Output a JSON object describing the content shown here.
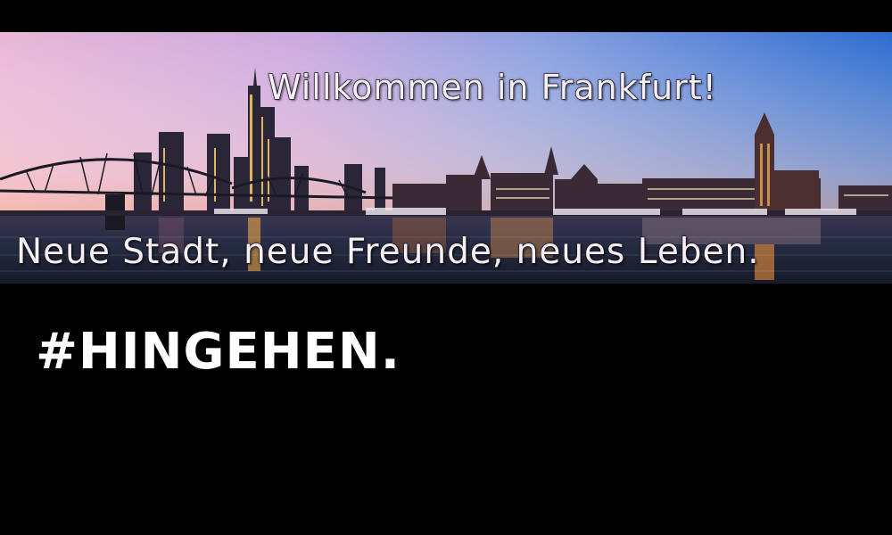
{
  "banner": {
    "headline": "Willkommen in Frankfurt!",
    "subline": "Neue Stadt, neue Freunde, neues Leben."
  },
  "hashtag": "#HINGEHEN.",
  "colors": {
    "background": "#000000",
    "sky_left": "#ecb9d8",
    "sky_right": "#2f6fd0",
    "water": "#1c2336",
    "text": "#ffffff"
  }
}
